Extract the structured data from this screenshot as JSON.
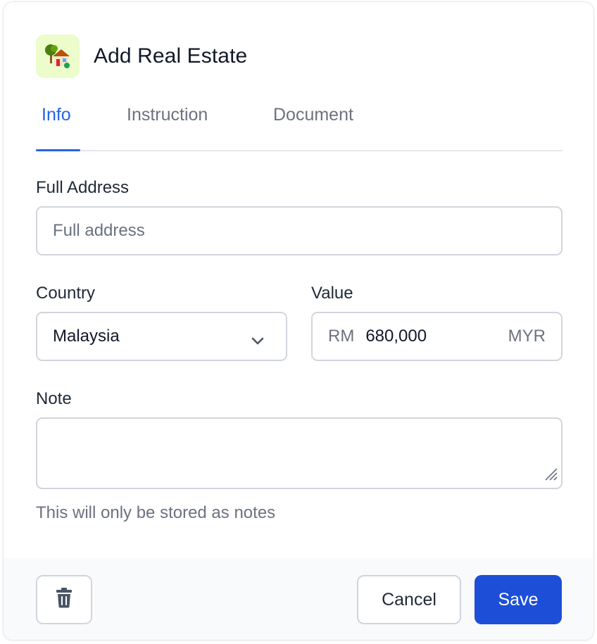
{
  "modal": {
    "title": "Add Real Estate",
    "icon": "house-with-tree-icon"
  },
  "tabs": [
    {
      "label": "Info",
      "active": true
    },
    {
      "label": "Instruction",
      "active": false
    },
    {
      "label": "Document",
      "active": false
    }
  ],
  "form": {
    "full_address": {
      "label": "Full Address",
      "placeholder": "Full address",
      "value": ""
    },
    "country": {
      "label": "Country",
      "value": "Malaysia"
    },
    "value": {
      "label": "Value",
      "prefix": "RM",
      "amount": "680,000",
      "currency": "MYR"
    },
    "note": {
      "label": "Note",
      "value": "",
      "help": "This will only be stored as notes"
    }
  },
  "footer": {
    "delete_icon": "trash-icon",
    "cancel_label": "Cancel",
    "save_label": "Save"
  },
  "colors": {
    "accent": "#2563eb",
    "save_button": "#1d4ed8",
    "icon_background": "#ecfccb"
  }
}
